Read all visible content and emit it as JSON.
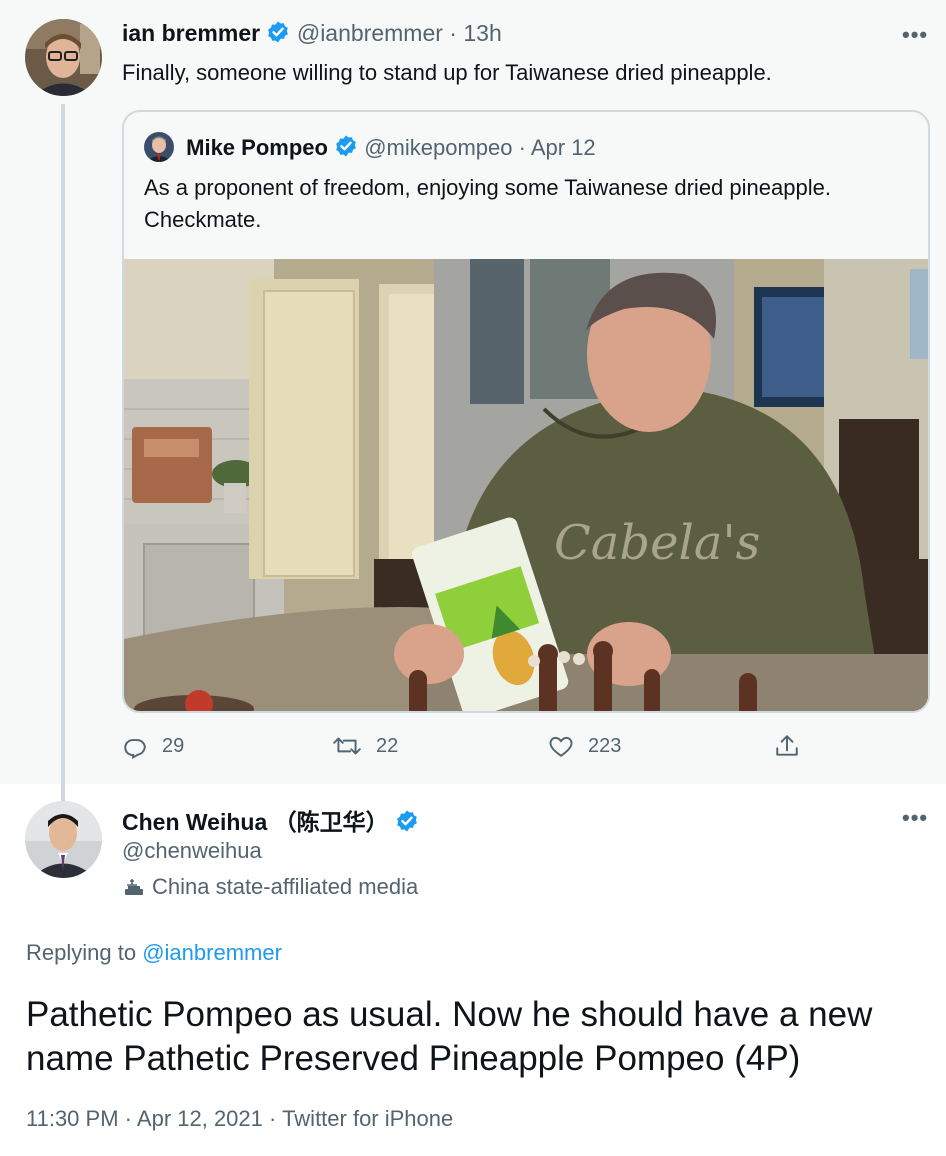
{
  "tweet1": {
    "author_name": "ian bremmer",
    "handle": "@ianbremmer",
    "time": "13h",
    "text": "Finally, someone willing to stand up for Taiwanese dried pineapple.",
    "more": "•••"
  },
  "quote": {
    "author_name": "Mike Pompeo",
    "handle": "@mikepompeo",
    "date": "Apr 12",
    "text": "As a proponent of freedom, enjoying some Taiwanese dried pineapple. Checkmate.",
    "photo_caption_text": "Cabela's"
  },
  "actions": {
    "replies": "29",
    "retweets": "22",
    "likes": "223"
  },
  "tweet2": {
    "author_name": "Chen Weihua （陈卫华）",
    "handle": "@chenweihua",
    "affiliation": "China state-affiliated media",
    "replying_prefix": "Replying to",
    "replying_to": "@ianbremmer",
    "text": "Pathetic Pompeo as usual. Now he should have a new name Pathetic Preserved Pineapple Pompeo (4P)",
    "time": "11:30 PM",
    "date": "Apr 12, 2021",
    "source": "Twitter for iPhone",
    "more": "•••"
  },
  "colors": {
    "accent": "#1d9bf0",
    "muted": "#536471",
    "highlight_bg": "#f7f9f9"
  },
  "icons": [
    "verified-icon",
    "reply-icon",
    "retweet-icon",
    "like-icon",
    "share-icon",
    "state-media-icon",
    "more-icon"
  ]
}
